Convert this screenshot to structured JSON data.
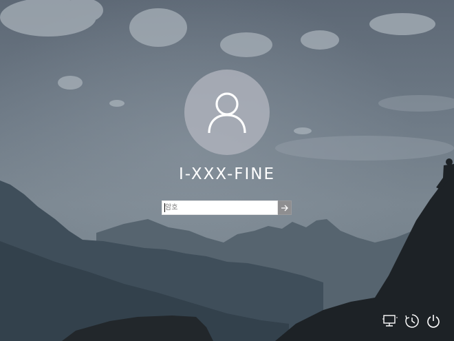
{
  "user": {
    "name": "I-XXX-FINE",
    "avatar_icon": "user-silhouette-icon"
  },
  "password_field": {
    "placeholder": "암호",
    "value": ""
  },
  "submit_button": {
    "icon": "arrow-right-icon"
  },
  "tray": [
    {
      "name": "network-icon"
    },
    {
      "name": "accessibility-icon"
    },
    {
      "name": "power-icon"
    }
  ],
  "colors": {
    "avatar_bg": "#afb2bc",
    "text": "#ffffff",
    "sky": "#6f7b87",
    "mountain": "#2a3844"
  }
}
